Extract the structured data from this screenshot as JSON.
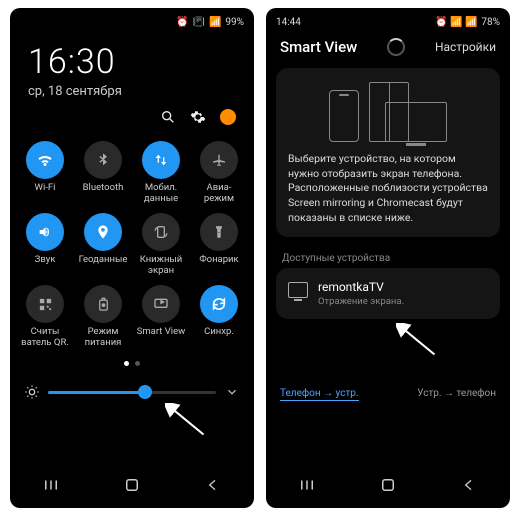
{
  "left_phone": {
    "status": {
      "battery": "99%",
      "alarm": "⏰",
      "vibrate": "📳",
      "signal": "📶"
    },
    "clock": {
      "time": "16:30",
      "date": "ср, 18 сентября"
    },
    "toolbar_icons": {
      "search": "search-icon",
      "settings": "gear-icon",
      "notif_count": ""
    },
    "qs": [
      {
        "label": "Wi-Fi",
        "on": true,
        "icon": "wifi"
      },
      {
        "label": "Bluetooth",
        "on": false,
        "icon": "bluetooth"
      },
      {
        "label": "Мобил.\nданные",
        "on": true,
        "icon": "updown"
      },
      {
        "label": "Авиа-\nрежим",
        "on": false,
        "icon": "plane"
      },
      {
        "label": "Звук",
        "on": true,
        "icon": "volume"
      },
      {
        "label": "Геоданные",
        "on": true,
        "icon": "pin"
      },
      {
        "label": "Книжный\nэкран",
        "on": false,
        "icon": "rotate"
      },
      {
        "label": "Фонарик",
        "on": false,
        "icon": "flash"
      },
      {
        "label": "Считы\nватель QR.",
        "on": false,
        "icon": "qr"
      },
      {
        "label": "Режим\nпитания",
        "on": false,
        "icon": "battery"
      },
      {
        "label": "Smart View",
        "on": false,
        "icon": "smartview"
      },
      {
        "label": "Синхр.",
        "on": true,
        "icon": "sync"
      }
    ],
    "brightness_pct": 58
  },
  "right_phone": {
    "status": {
      "time": "14:44",
      "battery": "78%",
      "signal_icons": "⏰ 📶 📶"
    },
    "header": {
      "title": "Smart View",
      "settings": "Настройки"
    },
    "description": "Выберите устройство, на котором нужно отобразить экран телефона. Расположенные поблизости устройства Screen mirroring и Chromecast будут показаны в списке ниже.",
    "section_label": "Доступные устройства",
    "device": {
      "name": "remontkaTV",
      "sub": "Отражение экрана."
    },
    "footer": {
      "mode_a": "Телефон → устр.",
      "mode_b": "Устр. → телефон"
    }
  }
}
